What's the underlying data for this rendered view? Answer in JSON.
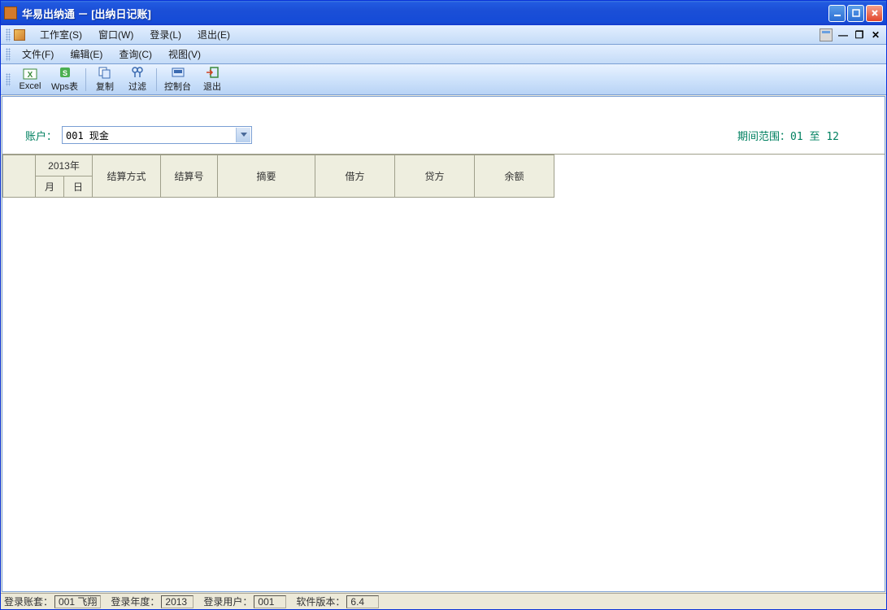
{
  "title": "华易出纳通 － [出纳日记账]",
  "menubar1": {
    "workspace": "工作室(S)",
    "window": "窗口(W)",
    "login": "登录(L)",
    "exit": "退出(E)"
  },
  "menubar2": {
    "file": "文件(F)",
    "edit": "编辑(E)",
    "query": "查询(C)",
    "view": "视图(V)"
  },
  "toolbar": {
    "excel": "Excel",
    "wps": "Wps表",
    "copy": "复制",
    "filter": "过滤",
    "console": "控制台",
    "exit": "退出"
  },
  "filter": {
    "account_label": "账户：",
    "account_value": "001 现金",
    "period_label": "期间范围：",
    "period_from": "01",
    "period_to": "至",
    "period_end": "12"
  },
  "grid": {
    "year": "2013年",
    "month": "月",
    "day": "日",
    "settle_type": "结算方式",
    "settle_no": "结算号",
    "summary": "摘要",
    "debit": "借方",
    "credit": "贷方",
    "balance": "余额"
  },
  "status": {
    "acct_set_label": "登录账套：",
    "acct_set_value": "001 飞翔",
    "year_label": "登录年度：",
    "year_value": "2013",
    "user_label": "登录用户：",
    "user_value": "001",
    "ver_label": "软件版本：",
    "ver_value": "6.4"
  }
}
